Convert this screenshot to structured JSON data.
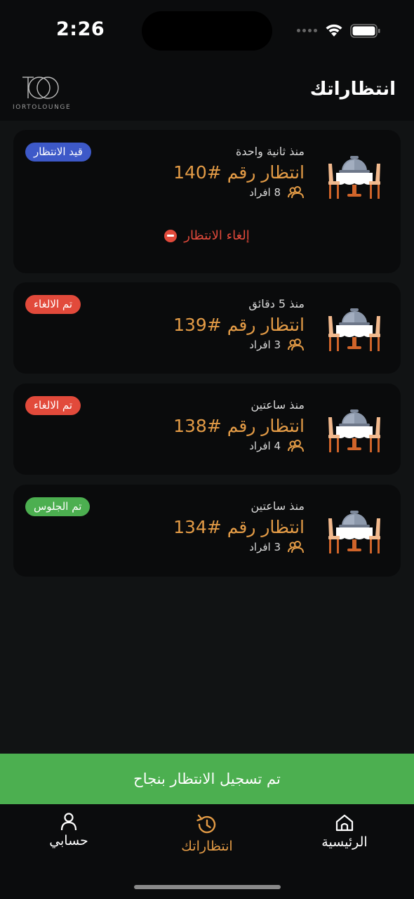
{
  "status_bar": {
    "time": "2:26"
  },
  "header": {
    "title": "انتظاراتك",
    "logo_text": "IORTOLOUNGE"
  },
  "colors": {
    "accent": "#e39b46",
    "pending": "#3d59c8",
    "cancelled": "#e24a3b",
    "seated": "#4caf50"
  },
  "waits": [
    {
      "since": "منذ ثانية واحدة",
      "title": "انتظار رقم #140",
      "people": "8 افراد",
      "status": "قيد الانتظار",
      "cancel_label": "إلغاء الانتظار"
    },
    {
      "since": "منذ 5 دقائق",
      "title": "انتظار رقم #139",
      "people": "3 افراد",
      "status": "تم الالغاء"
    },
    {
      "since": "منذ ساعتين",
      "title": "انتظار رقم #138",
      "people": "4 افراد",
      "status": "تم الالغاء"
    },
    {
      "since": "منذ ساعتين",
      "title": "انتظار رقم #134",
      "people": "3 افراد",
      "status": "تم الجلوس"
    }
  ],
  "toast": {
    "message": "تم تسجيل الانتظار بنجاح"
  },
  "nav": {
    "items": [
      {
        "label": "حسابي",
        "icon": "user-icon"
      },
      {
        "label": "انتظاراتك",
        "icon": "history-icon",
        "active": true
      },
      {
        "label": "الرئيسية",
        "icon": "home-icon"
      }
    ]
  }
}
